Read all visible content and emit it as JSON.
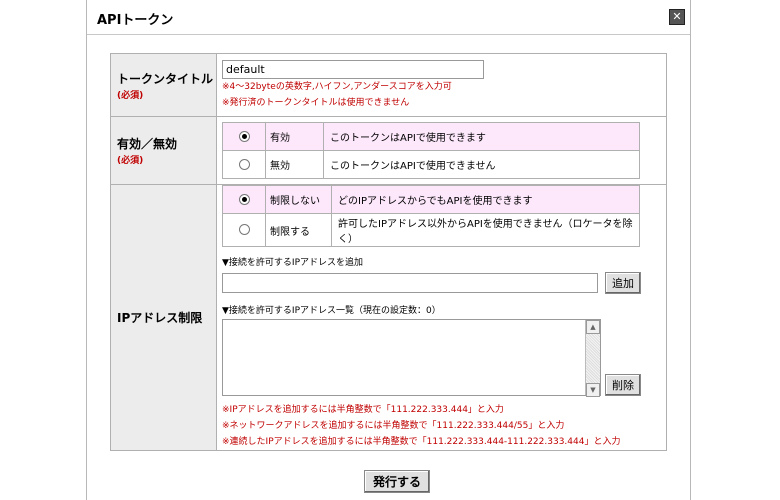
{
  "dialog": {
    "title": "APIトークン",
    "close_icon": "close-icon"
  },
  "token_title": {
    "label": "トークンタイトル",
    "required": "(必須)",
    "value": "default",
    "note1": "※4～32byteの英数字,ハイフン,アンダースコアを入力可",
    "note2": "※発行済のトークンタイトルは使用できません"
  },
  "enabled": {
    "label": "有効／無効",
    "required": "(必須)",
    "options": [
      {
        "label": "有効",
        "description": "このトークンはAPIで使用できます",
        "selected": true
      },
      {
        "label": "無効",
        "description": "このトークンはAPIで使用できません",
        "selected": false
      }
    ]
  },
  "ip": {
    "label": "IPアドレス制限",
    "options": [
      {
        "label": "制限しない",
        "description": "どのIPアドレスからでもAPIを使用できます",
        "selected": true
      },
      {
        "label": "制限する",
        "description": "許可したIPアドレス以外からAPIを使用できません（ロケータを除く）",
        "selected": false
      }
    ],
    "add_heading": "▼接続を許可するIPアドレスを追加",
    "add_button": "追加",
    "list_heading": "▼接続を許可するIPアドレス一覧（現在の設定数：0）",
    "delete_button": "削除",
    "note1": "※IPアドレスを追加するには半角整数で「111.222.333.444」と入力",
    "note2": "※ネットワークアドレスを追加するには半角整数で「111.222.333.444/55」と入力",
    "note3": "※連続したIPアドレスを追加するには半角整数で「111.222.333.444-111.222.333.444」と入力"
  },
  "submit": {
    "label": "発行する"
  },
  "colors": {
    "selected_row": "#fde8fb",
    "required": "#c00000",
    "label_bg": "#ececec"
  }
}
